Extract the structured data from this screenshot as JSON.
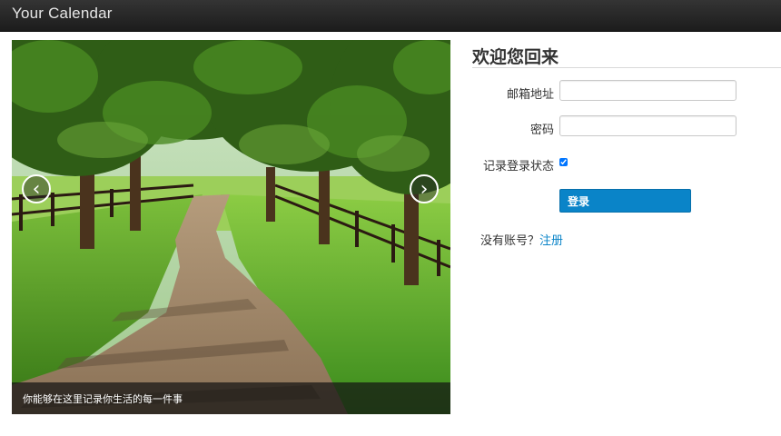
{
  "navbar": {
    "brand": "Your Calendar"
  },
  "carousel": {
    "caption": "你能够在这里记录你生活的每一件事",
    "prev_glyph": "‹",
    "next_glyph": "›"
  },
  "login": {
    "legend": "欢迎您回来",
    "email_label": "邮箱地址",
    "email_value": "",
    "password_label": "密码",
    "password_value": "",
    "remember_label": "记录登录状态",
    "remember_checked": true,
    "submit_label": "登录",
    "no_account_text": "没有账号？",
    "register_link": "注册"
  },
  "colors": {
    "navbar": "#222222",
    "primary_button": "#0a84c8",
    "link": "#0a84c8"
  }
}
